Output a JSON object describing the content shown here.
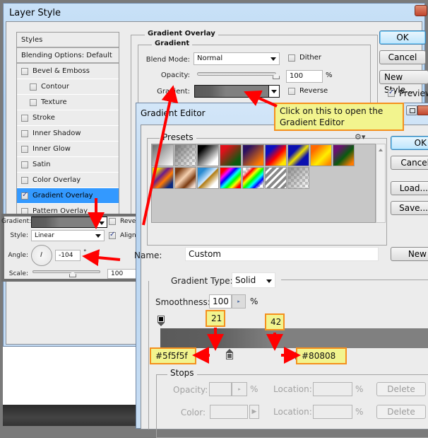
{
  "layer_style": {
    "title": "Layer Style",
    "styles_list": [
      {
        "label": "Styles",
        "type": "header"
      },
      {
        "label": "Blending Options: Default",
        "type": "header"
      },
      {
        "label": "Bevel & Emboss",
        "checked": false,
        "indent": 0
      },
      {
        "label": "Contour",
        "checked": false,
        "indent": 1
      },
      {
        "label": "Texture",
        "checked": false,
        "indent": 1
      },
      {
        "label": "Stroke",
        "checked": false,
        "indent": 0
      },
      {
        "label": "Inner Shadow",
        "checked": false,
        "indent": 0
      },
      {
        "label": "Inner Glow",
        "checked": false,
        "indent": 0
      },
      {
        "label": "Satin",
        "checked": false,
        "indent": 0
      },
      {
        "label": "Color Overlay",
        "checked": false,
        "indent": 0
      },
      {
        "label": "Gradient Overlay",
        "checked": true,
        "indent": 0,
        "selected": true
      },
      {
        "label": "Pattern Overlay",
        "checked": false,
        "indent": 0
      }
    ],
    "section_title": "Gradient Overlay",
    "group_title": "Gradient",
    "blend_mode_label": "Blend Mode:",
    "blend_mode_value": "Normal",
    "dither_label": "Dither",
    "opacity_label": "Opacity:",
    "opacity_value": "100",
    "opacity_unit": "%",
    "opacity_fraction": 1.0,
    "gradient_label": "Gradient:",
    "reverse_label": "Reverse",
    "buttons": {
      "ok": "OK",
      "cancel": "Cancel",
      "new_style": "New Style..."
    },
    "preview_label": "Preview"
  },
  "inset": {
    "gradient_label": "Gradient:",
    "reverse_label": "Reverse",
    "style_label": "Style:",
    "style_value": "Linear",
    "align_label": "Align with Layer",
    "angle_label": "Angle:",
    "angle_value": "-104",
    "angle_unit": "°",
    "scale_label": "Scale:",
    "scale_value": "100",
    "scale_unit": "%"
  },
  "gradient_editor": {
    "title": "Gradient Editor",
    "presets_label": "Presets",
    "buttons": {
      "ok": "OK",
      "cancel": "Cancel",
      "load": "Load...",
      "save": "Save...",
      "new": "New"
    },
    "name_label": "Name:",
    "name_value": "Custom",
    "gradient_type_label": "Gradient Type:",
    "gradient_type_value": "Solid",
    "smoothness_label": "Smoothness:",
    "smoothness_value": "100",
    "smoothness_unit": "%",
    "color_stops": [
      {
        "location": 21,
        "color": "#5f5f5f"
      },
      {
        "location": 42,
        "color": "#808080"
      }
    ],
    "stops": {
      "title": "Stops",
      "opacity_label": "Opacity:",
      "opacity_unit": "%",
      "location_label": "Location:",
      "location_unit": "%",
      "delete_label": "Delete",
      "color_label": "Color:"
    }
  },
  "callouts": {
    "open_editor": "Click on this to open the Gradient Editor",
    "stop1_location": "21",
    "stop2_location": "42",
    "stop1_color": "#5f5f5f",
    "stop2_color": "#80808"
  },
  "colors": {
    "selection": "#3399ff",
    "callout_bg": "#f2f48e",
    "callout_border": "#f4901e",
    "arrow": "#ff0000"
  }
}
